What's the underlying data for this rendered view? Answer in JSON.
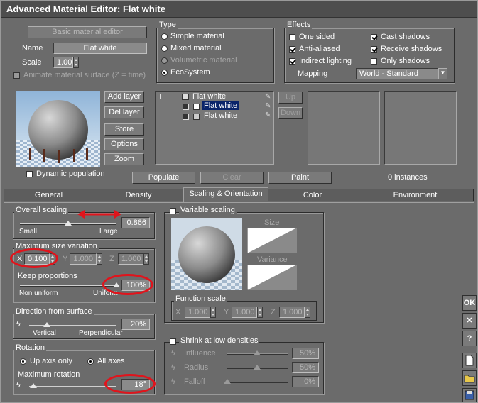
{
  "title": "Advanced Material Editor: Flat white",
  "basic": {
    "basic_button": "Basic material editor",
    "name_label": "Name",
    "name_value": "Flat white",
    "scale_label": "Scale",
    "scale_value": "1.00",
    "animate_label": "Animate material surface (Z = time)"
  },
  "type": {
    "title": "Type",
    "options": [
      "Simple material",
      "Mixed material",
      "Volumetric material",
      "EcoSystem"
    ],
    "selected": "EcoSystem"
  },
  "effects": {
    "title": "Effects",
    "one_sided": "One sided",
    "anti_aliased": "Anti-aliased",
    "indirect_lighting": "Indirect lighting",
    "cast_shadows": "Cast shadows",
    "receive_shadows": "Receive shadows",
    "only_shadows": "Only shadows",
    "mapping_label": "Mapping",
    "mapping_value": "World - Standard"
  },
  "layers": {
    "add": "Add layer",
    "del": "Del layer",
    "store": "Store",
    "options": "Options",
    "zoom": "Zoom",
    "dynamic_population": "Dynamic population",
    "tree": [
      "Flat white",
      "Flat white",
      "Flat white"
    ],
    "up": "Up",
    "down": "Down",
    "populate": "Populate",
    "clear": "Clear",
    "paint": "Paint",
    "instances": "0 instances"
  },
  "tabs": [
    "General",
    "Density",
    "Scaling & Orientation",
    "Color",
    "Environment"
  ],
  "active_tab": "Scaling & Orientation",
  "overall": {
    "title": "Overall scaling",
    "small": "Small",
    "large": "Large",
    "value": "0.866",
    "level": 0.5
  },
  "size_variation": {
    "title": "Maximum size variation",
    "x_label": "X",
    "x_value": "0.100",
    "y_label": "Y",
    "y_value": "1.000",
    "z_label": "Z",
    "z_value": "1.000",
    "keep_label": "Keep proportions",
    "non_uniform": "Non uniform",
    "uniform": "Uniform",
    "keep_value": "100%",
    "keep_level": 1.0
  },
  "direction": {
    "title": "Direction from surface",
    "vertical": "Vertical",
    "perpendicular": "Perpendicular",
    "value": "20%",
    "level": 0.2
  },
  "rotation": {
    "title": "Rotation",
    "up_axis": "Up axis only",
    "all_axes": "All axes",
    "max_label": "Maximum rotation",
    "value": "18°",
    "level": 0.05
  },
  "variable": {
    "title": "Variable scaling",
    "size": "Size",
    "variance": "Variance",
    "function_scale": "Function scale",
    "x_label": "X",
    "x_value": "1.000",
    "y_label": "Y",
    "y_value": "1.000",
    "z_label": "Z",
    "z_value": "1.000"
  },
  "shrink": {
    "title": "Shrink at low densities",
    "influence": "Influence",
    "influence_value": "50%",
    "radius": "Radius",
    "radius_value": "50%",
    "falloff": "Falloff",
    "falloff_value": "0%"
  },
  "side": {
    "ok": "OK",
    "close": "✕",
    "help": "?"
  },
  "colors": {
    "accent": "#0a246a",
    "annotation": "#e0141c"
  }
}
